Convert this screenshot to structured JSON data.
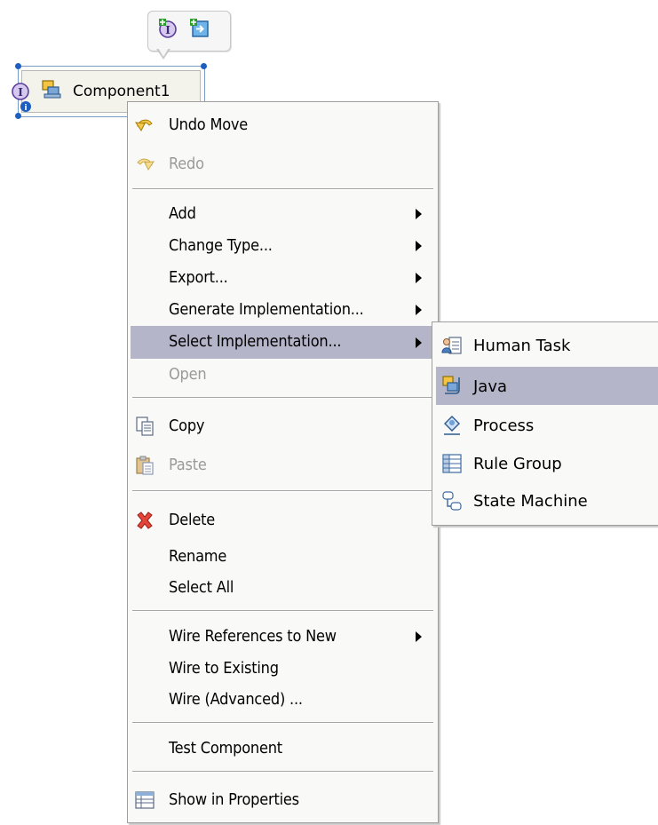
{
  "diagram": {
    "component_label": "Component1",
    "palette_icons": [
      "add-interface-icon",
      "add-reference-icon"
    ],
    "component_icons": [
      "interface-icon",
      "java-component-icon",
      "info-badge-icon"
    ]
  },
  "context_menu": {
    "items": [
      {
        "label": "Undo Move",
        "icon": "undo-icon",
        "enabled": true,
        "submenu": false
      },
      {
        "label": "Redo",
        "icon": "redo-icon",
        "enabled": false,
        "submenu": false
      },
      {
        "label": "Add",
        "icon": "",
        "enabled": true,
        "submenu": true
      },
      {
        "label": "Change Type...",
        "icon": "",
        "enabled": true,
        "submenu": true
      },
      {
        "label": "Export...",
        "icon": "",
        "enabled": true,
        "submenu": true
      },
      {
        "label": "Generate Implementation...",
        "icon": "",
        "enabled": true,
        "submenu": true
      },
      {
        "label": "Select Implementation...",
        "icon": "",
        "enabled": true,
        "submenu": true,
        "selected": true
      },
      {
        "label": "Open",
        "icon": "",
        "enabled": false,
        "submenu": false
      },
      {
        "label": "Copy",
        "icon": "copy-icon",
        "enabled": true,
        "submenu": false
      },
      {
        "label": "Paste",
        "icon": "paste-icon",
        "enabled": false,
        "submenu": false
      },
      {
        "label": "Delete",
        "icon": "delete-icon",
        "enabled": true,
        "submenu": false
      },
      {
        "label": "Rename",
        "icon": "",
        "enabled": true,
        "submenu": false
      },
      {
        "label": "Select All",
        "icon": "",
        "enabled": true,
        "submenu": false
      },
      {
        "label": "Wire References to New",
        "icon": "",
        "enabled": true,
        "submenu": true
      },
      {
        "label": "Wire to Existing",
        "icon": "",
        "enabled": true,
        "submenu": false
      },
      {
        "label": "Wire (Advanced) ...",
        "icon": "",
        "enabled": true,
        "submenu": false
      },
      {
        "label": "Test Component",
        "icon": "",
        "enabled": true,
        "submenu": false
      },
      {
        "label": "Show in Properties",
        "icon": "properties-icon",
        "enabled": true,
        "submenu": false
      }
    ]
  },
  "submenu": {
    "items": [
      {
        "label": "Human Task",
        "icon": "human-task-icon",
        "selected": false
      },
      {
        "label": "Java",
        "icon": "java-icon",
        "selected": true
      },
      {
        "label": "Process",
        "icon": "process-icon",
        "selected": false
      },
      {
        "label": "Rule Group",
        "icon": "rule-group-icon",
        "selected": false
      },
      {
        "label": "State Machine",
        "icon": "state-machine-icon",
        "selected": false
      }
    ]
  },
  "colors": {
    "selection": "#b5b5c9",
    "disabled_text": "#9a9a9a",
    "menu_bg": "#f9f9f7",
    "handle": "#1d5fc0"
  }
}
